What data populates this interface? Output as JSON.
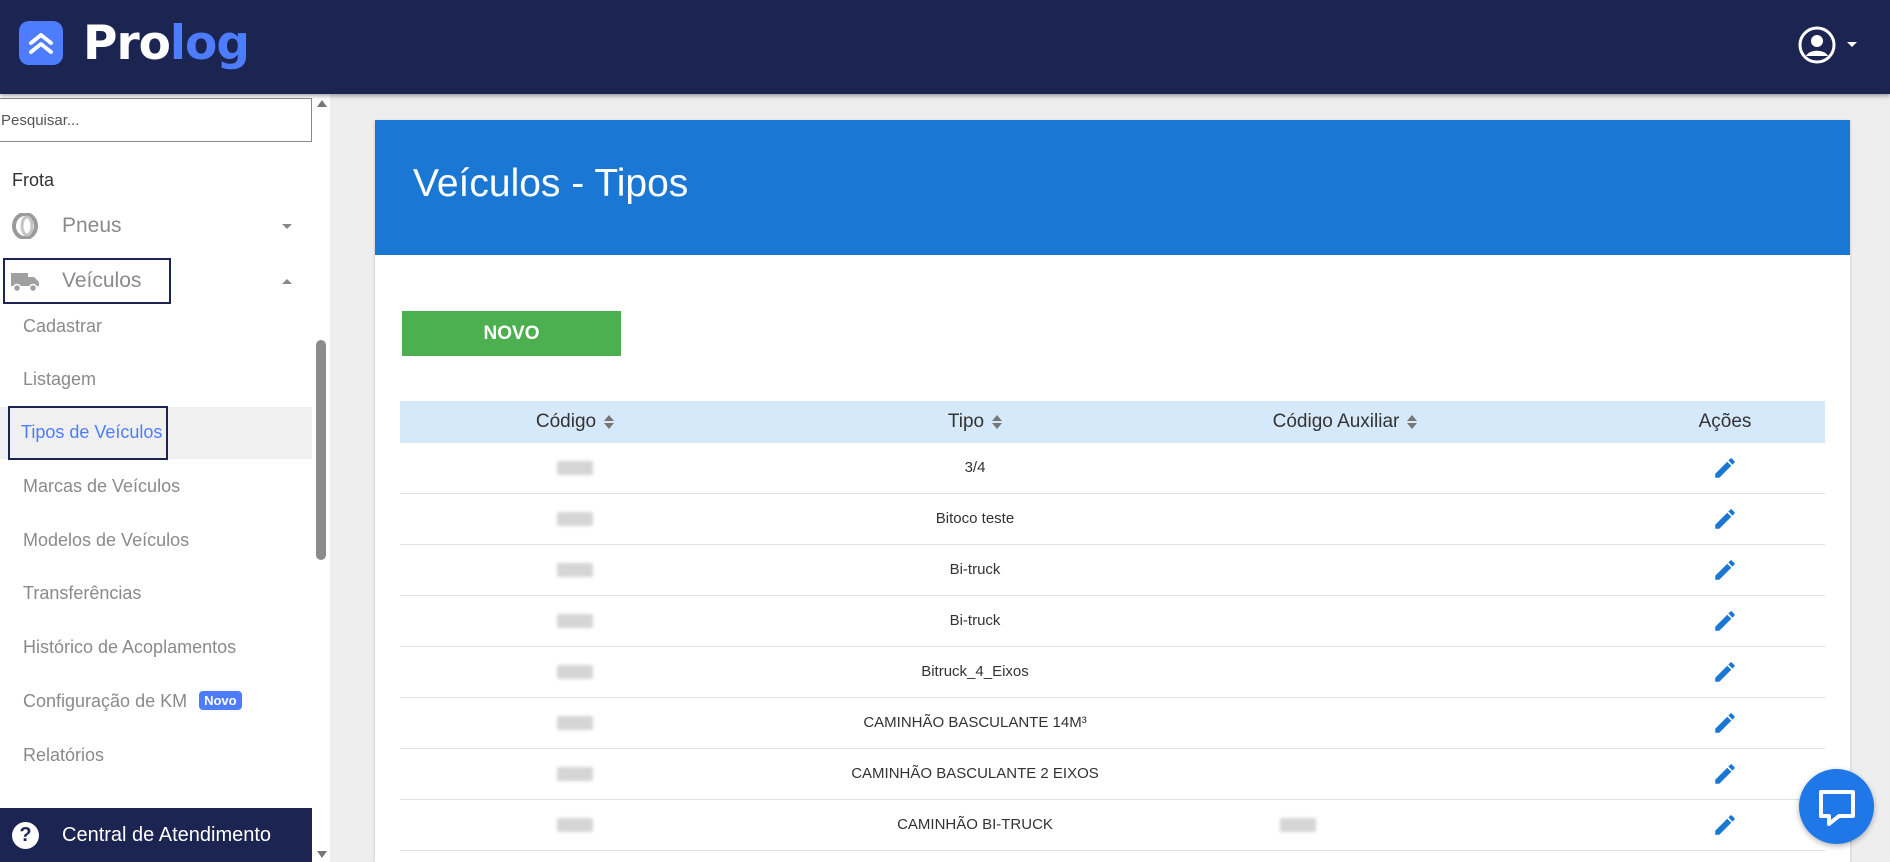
{
  "brand": {
    "name_part1": "Pro",
    "name_part2": "log",
    "accent": "#4d7cff",
    "navbar_bg": "#1c2452"
  },
  "header": {
    "user_icon": "account-circle-icon",
    "user_menu_caret": "caret-down-icon"
  },
  "sidebar": {
    "search_placeholder": "Pesquisar...",
    "section_label": "Frota",
    "groups": [
      {
        "label": "Pneus",
        "icon": "tire-icon",
        "expanded": false
      },
      {
        "label": "Veículos",
        "icon": "truck-icon",
        "expanded": true
      }
    ],
    "vehicle_items": [
      {
        "label": "Cadastrar"
      },
      {
        "label": "Listagem"
      },
      {
        "label": "Tipos de Veículos",
        "active": true
      },
      {
        "label": "Marcas de Veículos"
      },
      {
        "label": "Modelos de Veículos"
      },
      {
        "label": "Transferências"
      },
      {
        "label": "Histórico de Acoplamentos"
      },
      {
        "label": "Configuração de KM",
        "badge": "Novo"
      },
      {
        "label": "Relatórios"
      }
    ],
    "help_label": "Central de Atendimento"
  },
  "page": {
    "title": "Veículos - Tipos",
    "header_color": "#1a77d3",
    "new_button": "NOVO",
    "new_button_color": "#4caf50"
  },
  "table": {
    "columns": [
      "Código",
      "Tipo",
      "Código Auxiliar",
      "Ações"
    ],
    "rows": [
      {
        "codigo": "",
        "tipo": "3/4",
        "codigo_auxiliar": ""
      },
      {
        "codigo": "",
        "tipo": "Bitoco teste",
        "codigo_auxiliar": ""
      },
      {
        "codigo": "",
        "tipo": "Bi-truck",
        "codigo_auxiliar": ""
      },
      {
        "codigo": "",
        "tipo": "Bi-truck",
        "codigo_auxiliar": ""
      },
      {
        "codigo": "",
        "tipo": "Bitruck_4_Eixos",
        "codigo_auxiliar": ""
      },
      {
        "codigo": "",
        "tipo": "CAMINHÃO BASCULANTE 14M³",
        "codigo_auxiliar": ""
      },
      {
        "codigo": "",
        "tipo": "CAMINHÃO BASCULANTE 2 EIXOS",
        "codigo_auxiliar": ""
      },
      {
        "codigo": "",
        "tipo": "CAMINHÃO BI-TRUCK",
        "codigo_auxiliar": ""
      }
    ],
    "edit_icon": "pencil-icon",
    "edit_color": "#1a77d3"
  },
  "chat": {
    "icon": "chat-bubble-icon"
  }
}
